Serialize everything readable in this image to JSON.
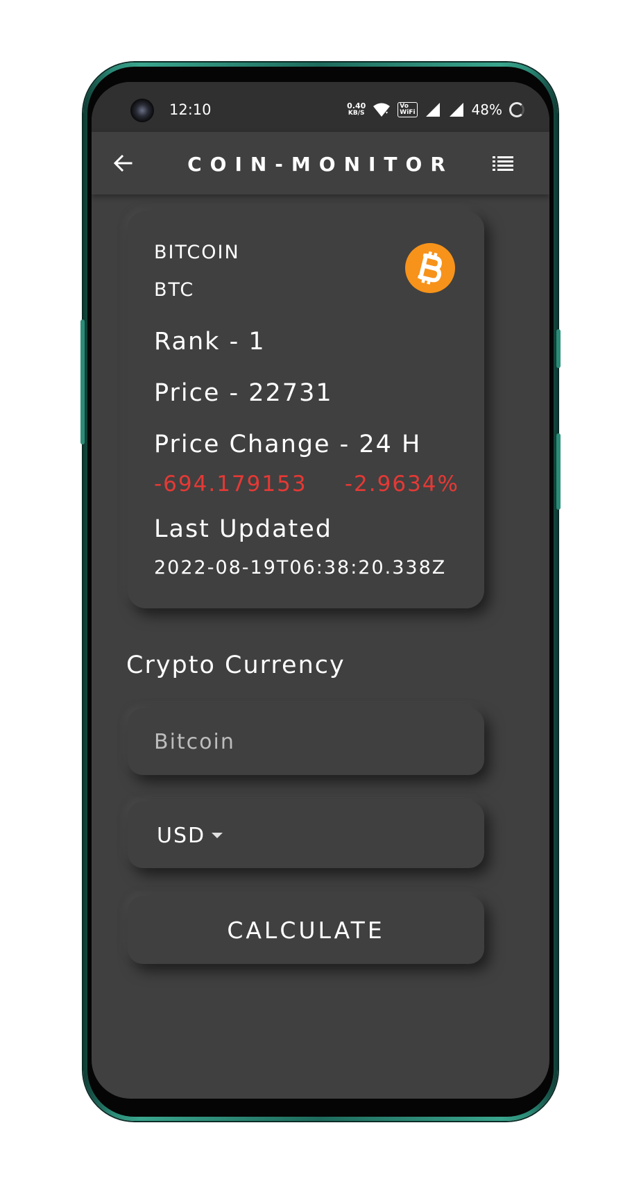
{
  "status_bar": {
    "time": "12:10",
    "net_speed_value": "0.40",
    "net_speed_unit": "KB/S",
    "vowifi_top": "Vo",
    "vowifi_bottom": "WiFi",
    "battery": "48%"
  },
  "app_bar": {
    "title": "COIN-MONITOR",
    "back_icon": "arrow-left",
    "menu_icon": "list"
  },
  "coin": {
    "name": "BITCOIN",
    "symbol": "BTC",
    "logo_icon": "bitcoin-logo",
    "logo_color": "#F7931A",
    "rank": "Rank - 1",
    "price": "Price - 22731",
    "price_change_label": "Price Change - 24 H",
    "price_change_abs": "-694.179153",
    "price_change_pct": "-2.9634%",
    "change_color": "#E53935",
    "last_updated_label": "Last Updated",
    "last_updated_value": "2022-08-19T06:38:20.338Z"
  },
  "form": {
    "section_label": "Crypto Currency",
    "crypto_placeholder": "Bitcoin",
    "crypto_value": "",
    "currency_selected": "USD",
    "calculate_label": "CALCULATE"
  },
  "theme": {
    "background": "#404040",
    "status_bar_bg": "#303030",
    "text": "#FFFFFF"
  }
}
